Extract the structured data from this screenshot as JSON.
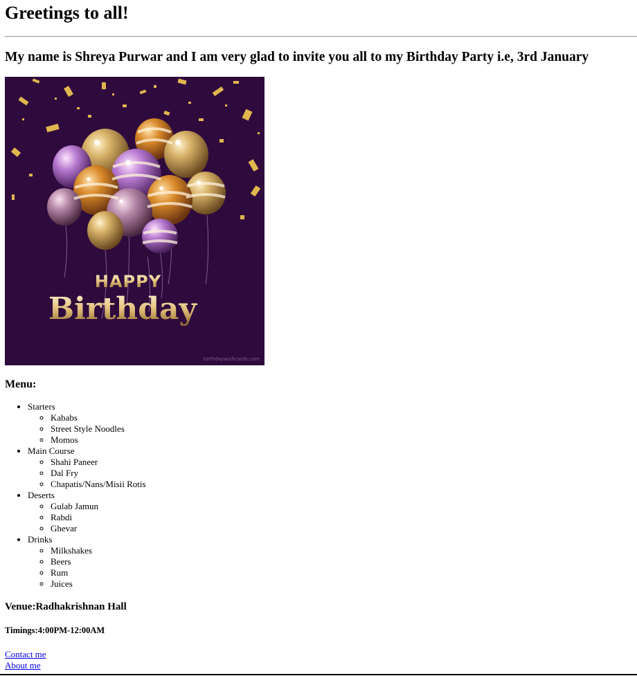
{
  "heading": "Greetings to all!",
  "intro": "My name is Shreya Purwar and I am very glad to invite you all to my Birthday Party i.e, 3rd January",
  "card": {
    "line1": "HAPPY",
    "line2": "Birthday",
    "watermark": "birthdaywishcards.com"
  },
  "menu": {
    "title": "Menu:",
    "categories": [
      {
        "name": "Starters",
        "items": [
          "Kababs",
          "Street Style Noodles",
          "Momos"
        ]
      },
      {
        "name": "Main Course",
        "items": [
          "Shahi Paneer",
          "Dal Fry",
          "Chapatis/Nans/Misii Rotis"
        ]
      },
      {
        "name": "Deserts",
        "items": [
          "Gulab Jamun",
          "Rabdi",
          "Ghevar"
        ]
      },
      {
        "name": "Drinks",
        "items": [
          "Milkshakes",
          "Beers",
          "Rum",
          "Juices"
        ]
      }
    ]
  },
  "venue": "Venue:Radhakrishnan Hall",
  "timings": "Timings:4:00PM-12:00AM",
  "links": {
    "contact": "Contact me",
    "about": "About me"
  },
  "colors": {
    "card_background": "#2f0a3d",
    "link": "#0000ee",
    "gold": "#d9b36a"
  }
}
